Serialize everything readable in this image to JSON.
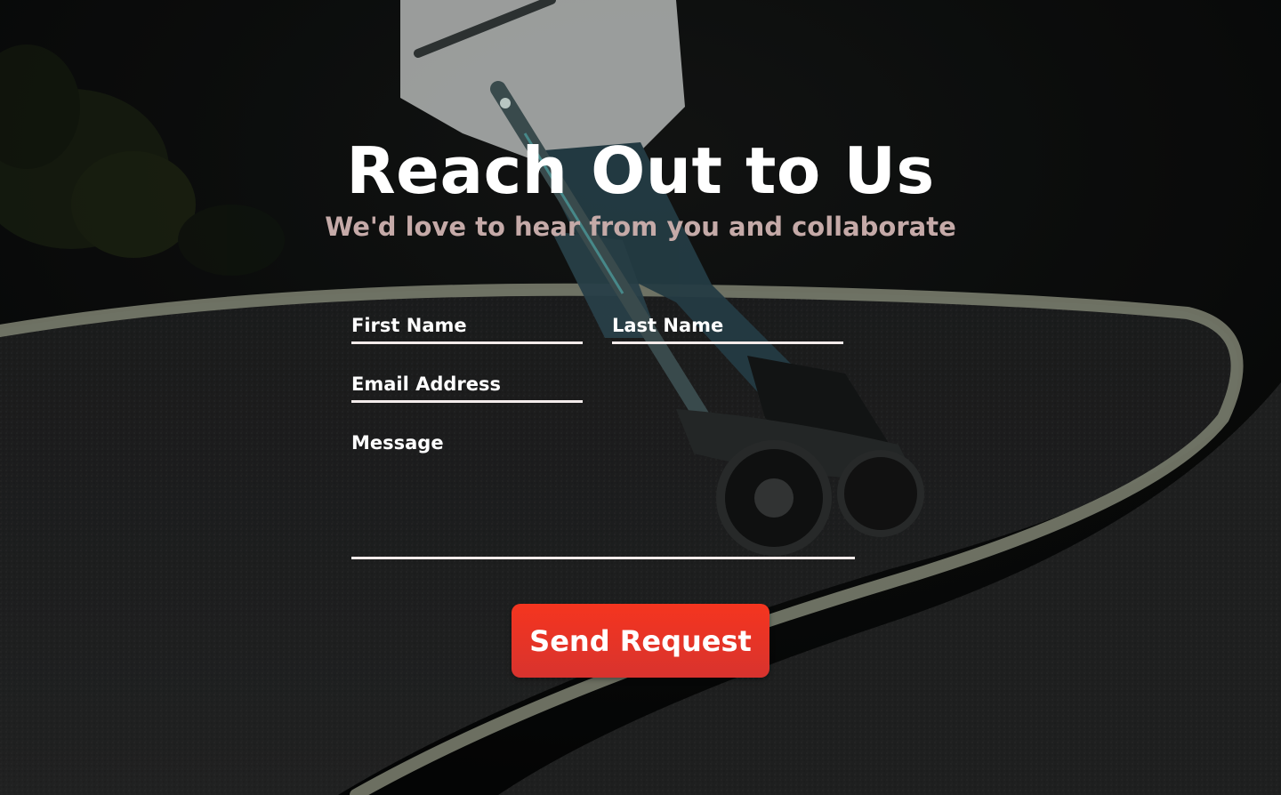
{
  "header": {
    "title": "Reach Out to Us",
    "subtitle": "We'd love to hear from you and collaborate"
  },
  "form": {
    "first_name_label": "First Name",
    "first_name_value": "",
    "last_name_label": "Last Name",
    "last_name_value": "",
    "email_label": "Email Address",
    "email_value": "",
    "message_label": "Message",
    "message_value": "",
    "submit_label": "Send Request"
  },
  "colors": {
    "title": "#ffffff",
    "subtitle": "#c5aaa8",
    "field_line": "#f3ebea",
    "button": "#e8352a",
    "background": "#0b0c0c"
  },
  "background_image": {
    "subject": "rider on electric scooter leaning into a curve on a dark asphalt track"
  }
}
